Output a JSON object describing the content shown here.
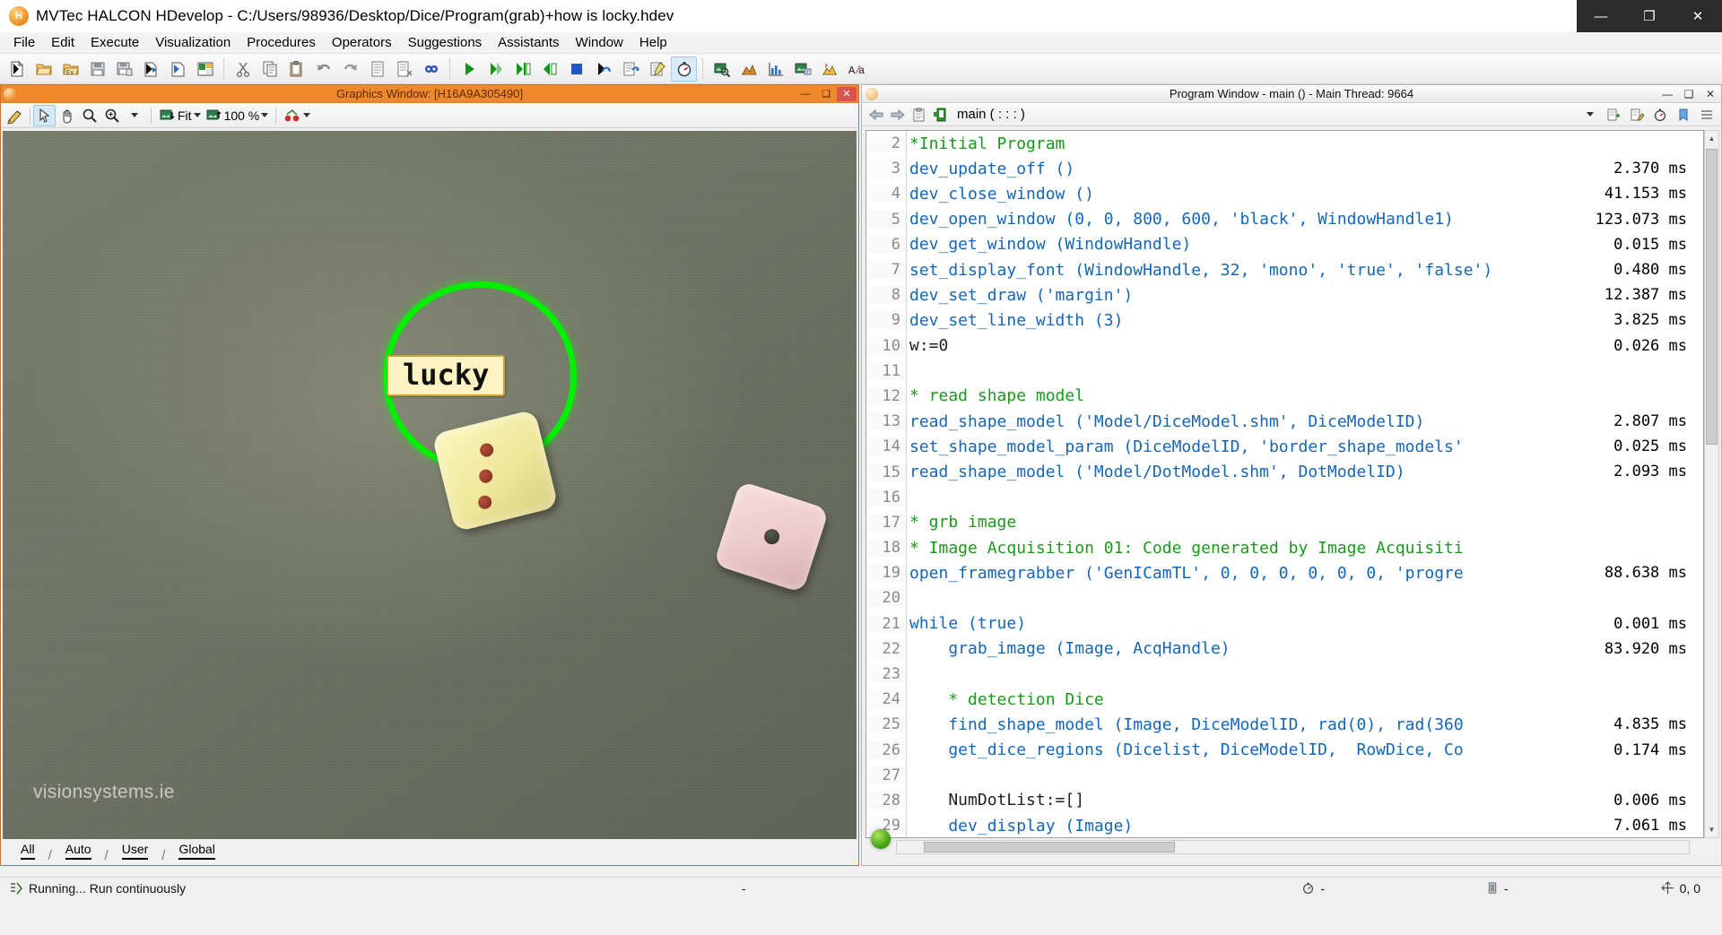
{
  "app": {
    "title": "MVTec HALCON HDevelop - C:/Users/98936/Desktop/Dice/Program(grab)+how is locky.hdev",
    "icon": "halcon-logo-icon",
    "window_buttons": {
      "minimize": "—",
      "maximize": "❐",
      "close": "✕"
    }
  },
  "menubar": {
    "items": [
      {
        "label": "File"
      },
      {
        "label": "Edit"
      },
      {
        "label": "Execute"
      },
      {
        "label": "Visualization"
      },
      {
        "label": "Procedures"
      },
      {
        "label": "Operators"
      },
      {
        "label": "Suggestions"
      },
      {
        "label": "Assistants"
      },
      {
        "label": "Window"
      },
      {
        "label": "Help"
      }
    ]
  },
  "toolbar": {
    "groups": [
      {
        "buttons": [
          {
            "name": "new-program-icon",
            "title": "New Program"
          },
          {
            "name": "open-program-icon",
            "title": "Open Program"
          },
          {
            "name": "open-example-icon",
            "title": "Open Example Program"
          },
          {
            "name": "save-program-icon",
            "title": "Save Program"
          },
          {
            "name": "save-as-icon",
            "title": "Save Program As"
          },
          {
            "name": "import-procedure-icon",
            "title": "Import Procedure"
          },
          {
            "name": "export-procedure-icon",
            "title": "Export Procedure"
          },
          {
            "name": "export-code-icon",
            "title": "Export Code"
          }
        ]
      },
      {
        "buttons": [
          {
            "name": "cut-icon",
            "title": "Cut"
          },
          {
            "name": "copy-icon",
            "title": "Copy"
          },
          {
            "name": "paste-icon",
            "title": "Paste"
          },
          {
            "name": "undo-icon",
            "title": "Undo"
          },
          {
            "name": "redo-icon",
            "title": "Redo"
          },
          {
            "name": "comment-icon",
            "title": "Comment"
          },
          {
            "name": "uncomment-icon",
            "title": "Uncomment"
          },
          {
            "name": "find-icon",
            "title": "Find"
          }
        ]
      },
      {
        "buttons": [
          {
            "name": "run-icon",
            "title": "Run"
          },
          {
            "name": "step-over-icon",
            "title": "Step Over"
          },
          {
            "name": "step-into-icon",
            "title": "Step Into"
          },
          {
            "name": "step-out-icon",
            "title": "Step Out"
          },
          {
            "name": "stop-icon",
            "title": "Stop"
          },
          {
            "name": "reset-program-icon",
            "title": "Reset Program Execution"
          },
          {
            "name": "continue-icon",
            "title": "Continue"
          },
          {
            "name": "activate-code-icon",
            "title": "Activate / Deactivate"
          },
          {
            "name": "stopwatch-icon",
            "title": "Measure Runtime"
          }
        ]
      },
      {
        "buttons": [
          {
            "name": "image-variable-icon",
            "title": "Image Variable Window"
          },
          {
            "name": "gray-histogram-icon",
            "title": "Gray Value Histogram"
          },
          {
            "name": "feature-histogram-icon",
            "title": "Feature Histogram"
          },
          {
            "name": "image-acquisition-icon",
            "title": "Image Acquisition Assistant"
          },
          {
            "name": "matching-icon",
            "title": "Matching Assistant"
          },
          {
            "name": "ocr-assistant-icon",
            "title": "OCR Assistant"
          }
        ]
      }
    ]
  },
  "graphics_window": {
    "title": "Graphics Window: [H16A9A305490]",
    "icon": "halcon-logo-icon",
    "window_buttons": {
      "minimize": "—",
      "maximize": "❑",
      "close": "✕"
    },
    "toolbar": {
      "draw_mode": "draw-region-icon",
      "select_tool": "arrow-select-icon",
      "pan_tool": "hand-pan-icon",
      "zoom_tool": "magnifier-icon",
      "zoom_in_tool": "magnifier-plus-icon",
      "fit_label": "Fit",
      "zoom_label": "100 %",
      "color_tool": "cherries-color-icon"
    },
    "image": {
      "label_text": "lucky",
      "watermark": "visionsystems.ie",
      "detected_die_pips": 3,
      "background_die_pips": 1
    },
    "tabs": [
      {
        "label": "All",
        "selected": true
      },
      {
        "label": "Auto",
        "selected": false
      },
      {
        "label": "User",
        "selected": false
      },
      {
        "label": "Global",
        "selected": false
      }
    ]
  },
  "program_window": {
    "title": "Program Window - main () - Main Thread: 9664",
    "icon": "halcon-logo-icon",
    "window_buttons": {
      "minimize": "—",
      "maximize": "❑",
      "close": "✕"
    },
    "toolbar": {
      "back_icon": "arrow-back-icon",
      "forward_icon": "arrow-forward-icon",
      "clipboard_icon": "clipboard-icon",
      "procedure_icon": "procedure-icon",
      "procedure_name": "main ( : : : )",
      "dropdown_icon": "chevron-down-icon",
      "right_icons": [
        {
          "name": "insert-procedure-icon"
        },
        {
          "name": "edit-procedure-icon"
        },
        {
          "name": "stopwatch-icon"
        },
        {
          "name": "profile-dropdown-icon"
        },
        {
          "name": "bookmark-icon"
        },
        {
          "name": "list-icon"
        }
      ]
    },
    "code": [
      {
        "num": "2",
        "text": "*Initial Program",
        "type": "comment",
        "indent": 0,
        "time": ""
      },
      {
        "num": "3",
        "text": "dev_update_off ()",
        "type": "op",
        "indent": 0,
        "time": "2.370 ms"
      },
      {
        "num": "4",
        "text": "dev_close_window ()",
        "type": "op",
        "indent": 0,
        "time": "41.153 ms"
      },
      {
        "num": "5",
        "text": "dev_open_window (0, 0, 800, 600, 'black', WindowHandle1)",
        "type": "op",
        "indent": 0,
        "time": "123.073 ms"
      },
      {
        "num": "6",
        "text": "dev_get_window (WindowHandle)",
        "type": "op",
        "indent": 0,
        "time": "0.015 ms"
      },
      {
        "num": "7",
        "text": "set_display_font (WindowHandle, 32, 'mono', 'true', 'false')",
        "type": "op",
        "indent": 0,
        "time": "0.480 ms"
      },
      {
        "num": "8",
        "text": "dev_set_draw ('margin')",
        "type": "op",
        "indent": 0,
        "time": "12.387 ms"
      },
      {
        "num": "9",
        "text": "dev_set_line_width (3)",
        "type": "op",
        "indent": 0,
        "time": "3.825 ms"
      },
      {
        "num": "10",
        "text": "w:=0",
        "type": "plain",
        "indent": 0,
        "time": "0.026 ms"
      },
      {
        "num": "11",
        "text": "",
        "type": "plain",
        "indent": 0,
        "time": ""
      },
      {
        "num": "12",
        "text": "* read shape model",
        "type": "comment",
        "indent": 0,
        "time": ""
      },
      {
        "num": "13",
        "text": "read_shape_model ('Model/DiceModel.shm', DiceModelID)",
        "type": "op",
        "indent": 0,
        "time": "2.807 ms"
      },
      {
        "num": "14",
        "text": "set_shape_model_param (DiceModelID, 'border_shape_models'",
        "type": "op",
        "indent": 0,
        "time": "0.025 ms"
      },
      {
        "num": "15",
        "text": "read_shape_model ('Model/DotModel.shm', DotModelID)",
        "type": "op",
        "indent": 0,
        "time": "2.093 ms"
      },
      {
        "num": "16",
        "text": "",
        "type": "plain",
        "indent": 0,
        "time": ""
      },
      {
        "num": "17",
        "text": "* grb image",
        "type": "comment",
        "indent": 0,
        "time": ""
      },
      {
        "num": "18",
        "text": "* Image Acquisition 01: Code generated by Image Acquisiti",
        "type": "comment",
        "indent": 0,
        "time": ""
      },
      {
        "num": "19",
        "text": "open_framegrabber ('GenICamTL', 0, 0, 0, 0, 0, 0, 'progre",
        "type": "op",
        "indent": 0,
        "time": "88.638 ms"
      },
      {
        "num": "20",
        "text": "",
        "type": "plain",
        "indent": 0,
        "time": ""
      },
      {
        "num": "21",
        "text": "while (true)",
        "type": "kw",
        "indent": 0,
        "time": "0.001 ms"
      },
      {
        "num": "22",
        "text": "grab_image (Image, AcqHandle)",
        "type": "op",
        "indent": 1,
        "time": "83.920 ms"
      },
      {
        "num": "23",
        "text": "",
        "type": "plain",
        "indent": 1,
        "time": ""
      },
      {
        "num": "24",
        "text": "* detection Dice",
        "type": "comment",
        "indent": 1,
        "time": ""
      },
      {
        "num": "25",
        "text": "find_shape_model (Image, DiceModelID, rad(0), rad(360",
        "type": "op",
        "indent": 1,
        "time": "4.835 ms"
      },
      {
        "num": "26",
        "text": "get_dice_regions (Dicelist, DiceModelID,  RowDice, Co",
        "type": "proc",
        "indent": 1,
        "time": "0.174 ms"
      },
      {
        "num": "27",
        "text": "",
        "type": "plain",
        "indent": 1,
        "time": ""
      },
      {
        "num": "28",
        "text": "NumDotList:=[]",
        "type": "plain",
        "indent": 1,
        "time": "0.006 ms"
      },
      {
        "num": "29",
        "text": "dev_display (Image)",
        "type": "op",
        "indent": 1,
        "time": "7.061 ms"
      }
    ]
  },
  "statusbar": {
    "run_icon": "running-icon",
    "status_text": "Running... Run continuously",
    "separator_value": "-",
    "clock_icon": "stopwatch-icon",
    "clock_value": "-",
    "memory_icon": "memory-icon",
    "memory_value": "-",
    "cursor_icon": "crosshair-icon",
    "cursor_value": "0, 0"
  },
  "colors": {
    "accent_orange": "#f0892b",
    "comment_green": "#1a9a1a",
    "operator_blue": "#1466b8",
    "circle_green": "#00f000",
    "label_bg": "#fff3c4",
    "canvas_bg": "#6f7465"
  }
}
